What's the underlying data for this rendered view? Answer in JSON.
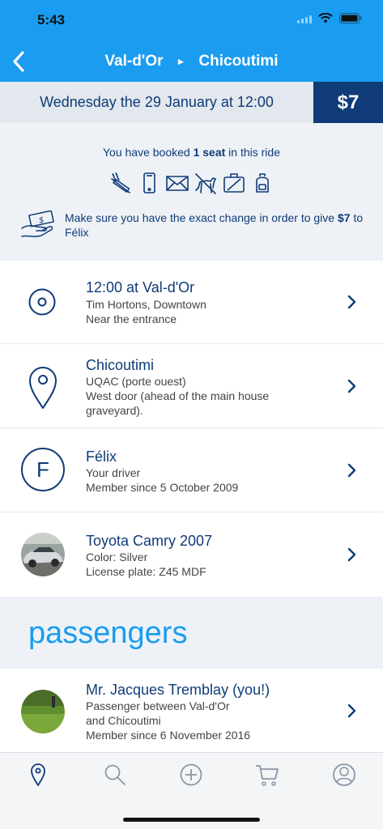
{
  "status": {
    "time": "5:43"
  },
  "header": {
    "origin": "Val-d'Or",
    "destination": "Chicoutimi",
    "arrow": "►"
  },
  "trip": {
    "date": "Wednesday the 29 January at 12:00",
    "price": "$7"
  },
  "booking": {
    "pre": "You have booked ",
    "seats": "1 seat",
    "post": " in this ride",
    "amenities": [
      "no-smoking-icon",
      "phone-icon",
      "mail-icon",
      "no-pets-icon",
      "no-luggage-icon",
      "backpack-icon"
    ],
    "change_pre": "Make sure you have the exact change in order to give ",
    "change_amount": "$7",
    "change_post": " to Félix"
  },
  "departure": {
    "title": "12:00 at Val-d'Or",
    "place": "Tim Hortons, Downtown",
    "note": "Near the entrance"
  },
  "arrival": {
    "title": "Chicoutimi",
    "place": "UQAC (porte ouest)",
    "note": "West door (ahead of the main house graveyard)."
  },
  "driver": {
    "initial": "F",
    "name": "Félix",
    "role": "Your driver",
    "since": "Member since 5 October 2009"
  },
  "car": {
    "model": "Toyota Camry 2007",
    "color": "Color: Silver",
    "plate": "License plate: Z45 MDF"
  },
  "passengers": {
    "heading": "passengers",
    "items": [
      {
        "name": "Mr. Jacques Tremblay (you!)",
        "line1": "Passenger between Val-d'Or",
        "line2": "and Chicoutimi",
        "since": "Member since 6 November 2016"
      }
    ]
  },
  "tabs": [
    "map-pin-icon",
    "search-icon",
    "add-icon",
    "cart-icon",
    "profile-icon"
  ],
  "colors": {
    "primary": "#1a9cf0",
    "navy": "#0f3b78",
    "background": "#eef2f6"
  }
}
